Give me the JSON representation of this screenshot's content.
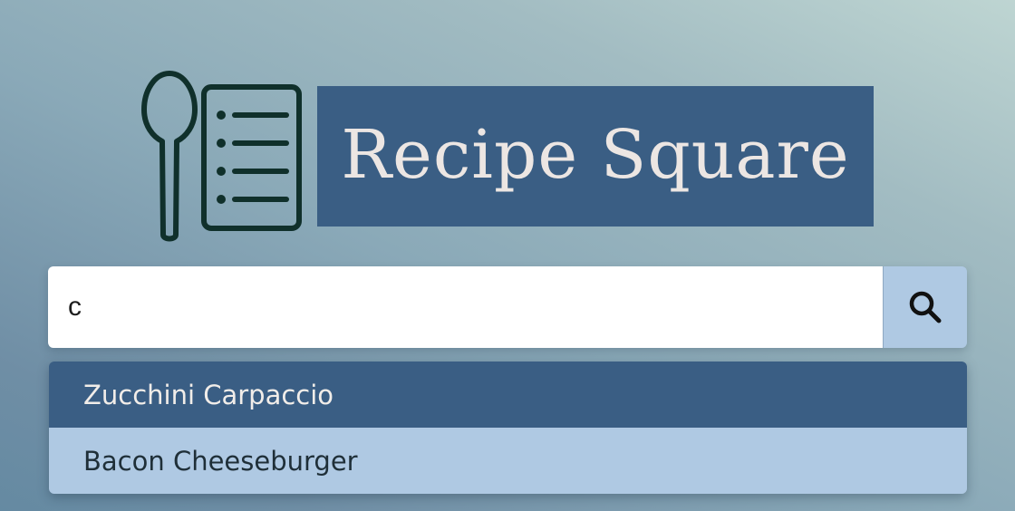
{
  "logo": {
    "icon": "spoon-and-recipe-list-icon",
    "title": "Recipe Square"
  },
  "search": {
    "value": "c",
    "button_icon": "search-icon"
  },
  "suggestions": [
    {
      "label": "Zucchini Carpaccio",
      "highlighted": true
    },
    {
      "label": "Bacon Cheeseburger",
      "highlighted": false
    }
  ],
  "colors": {
    "brand_blue": "#3a5e84",
    "light_blue": "#afc9e3",
    "icon_dark": "#10302b"
  }
}
